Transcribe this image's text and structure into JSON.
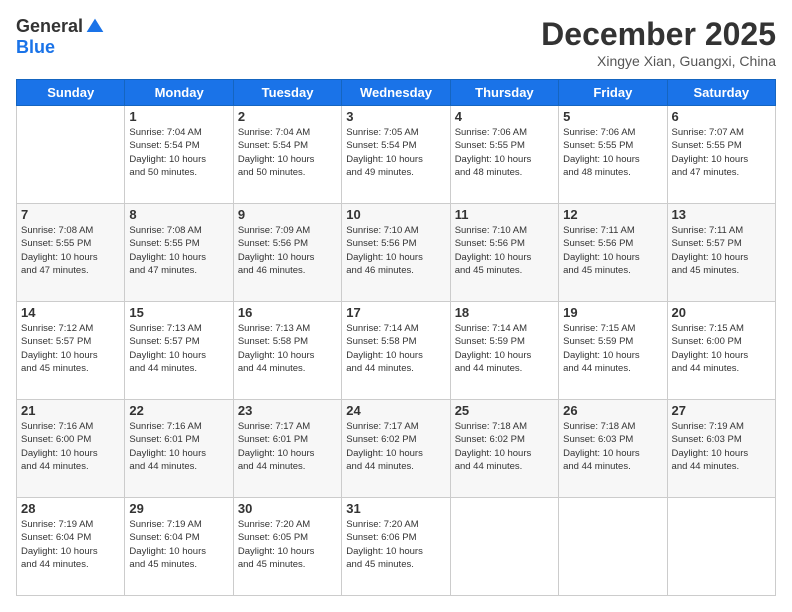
{
  "logo": {
    "general": "General",
    "blue": "Blue"
  },
  "header": {
    "month": "December 2025",
    "location": "Xingye Xian, Guangxi, China"
  },
  "weekdays": [
    "Sunday",
    "Monday",
    "Tuesday",
    "Wednesday",
    "Thursday",
    "Friday",
    "Saturday"
  ],
  "weeks": [
    [
      {
        "day": "",
        "info": ""
      },
      {
        "day": "1",
        "info": "Sunrise: 7:04 AM\nSunset: 5:54 PM\nDaylight: 10 hours\nand 50 minutes."
      },
      {
        "day": "2",
        "info": "Sunrise: 7:04 AM\nSunset: 5:54 PM\nDaylight: 10 hours\nand 50 minutes."
      },
      {
        "day": "3",
        "info": "Sunrise: 7:05 AM\nSunset: 5:54 PM\nDaylight: 10 hours\nand 49 minutes."
      },
      {
        "day": "4",
        "info": "Sunrise: 7:06 AM\nSunset: 5:55 PM\nDaylight: 10 hours\nand 48 minutes."
      },
      {
        "day": "5",
        "info": "Sunrise: 7:06 AM\nSunset: 5:55 PM\nDaylight: 10 hours\nand 48 minutes."
      },
      {
        "day": "6",
        "info": "Sunrise: 7:07 AM\nSunset: 5:55 PM\nDaylight: 10 hours\nand 47 minutes."
      }
    ],
    [
      {
        "day": "7",
        "info": "Sunrise: 7:08 AM\nSunset: 5:55 PM\nDaylight: 10 hours\nand 47 minutes."
      },
      {
        "day": "8",
        "info": "Sunrise: 7:08 AM\nSunset: 5:55 PM\nDaylight: 10 hours\nand 47 minutes."
      },
      {
        "day": "9",
        "info": "Sunrise: 7:09 AM\nSunset: 5:56 PM\nDaylight: 10 hours\nand 46 minutes."
      },
      {
        "day": "10",
        "info": "Sunrise: 7:10 AM\nSunset: 5:56 PM\nDaylight: 10 hours\nand 46 minutes."
      },
      {
        "day": "11",
        "info": "Sunrise: 7:10 AM\nSunset: 5:56 PM\nDaylight: 10 hours\nand 45 minutes."
      },
      {
        "day": "12",
        "info": "Sunrise: 7:11 AM\nSunset: 5:56 PM\nDaylight: 10 hours\nand 45 minutes."
      },
      {
        "day": "13",
        "info": "Sunrise: 7:11 AM\nSunset: 5:57 PM\nDaylight: 10 hours\nand 45 minutes."
      }
    ],
    [
      {
        "day": "14",
        "info": "Sunrise: 7:12 AM\nSunset: 5:57 PM\nDaylight: 10 hours\nand 45 minutes."
      },
      {
        "day": "15",
        "info": "Sunrise: 7:13 AM\nSunset: 5:57 PM\nDaylight: 10 hours\nand 44 minutes."
      },
      {
        "day": "16",
        "info": "Sunrise: 7:13 AM\nSunset: 5:58 PM\nDaylight: 10 hours\nand 44 minutes."
      },
      {
        "day": "17",
        "info": "Sunrise: 7:14 AM\nSunset: 5:58 PM\nDaylight: 10 hours\nand 44 minutes."
      },
      {
        "day": "18",
        "info": "Sunrise: 7:14 AM\nSunset: 5:59 PM\nDaylight: 10 hours\nand 44 minutes."
      },
      {
        "day": "19",
        "info": "Sunrise: 7:15 AM\nSunset: 5:59 PM\nDaylight: 10 hours\nand 44 minutes."
      },
      {
        "day": "20",
        "info": "Sunrise: 7:15 AM\nSunset: 6:00 PM\nDaylight: 10 hours\nand 44 minutes."
      }
    ],
    [
      {
        "day": "21",
        "info": "Sunrise: 7:16 AM\nSunset: 6:00 PM\nDaylight: 10 hours\nand 44 minutes."
      },
      {
        "day": "22",
        "info": "Sunrise: 7:16 AM\nSunset: 6:01 PM\nDaylight: 10 hours\nand 44 minutes."
      },
      {
        "day": "23",
        "info": "Sunrise: 7:17 AM\nSunset: 6:01 PM\nDaylight: 10 hours\nand 44 minutes."
      },
      {
        "day": "24",
        "info": "Sunrise: 7:17 AM\nSunset: 6:02 PM\nDaylight: 10 hours\nand 44 minutes."
      },
      {
        "day": "25",
        "info": "Sunrise: 7:18 AM\nSunset: 6:02 PM\nDaylight: 10 hours\nand 44 minutes."
      },
      {
        "day": "26",
        "info": "Sunrise: 7:18 AM\nSunset: 6:03 PM\nDaylight: 10 hours\nand 44 minutes."
      },
      {
        "day": "27",
        "info": "Sunrise: 7:19 AM\nSunset: 6:03 PM\nDaylight: 10 hours\nand 44 minutes."
      }
    ],
    [
      {
        "day": "28",
        "info": "Sunrise: 7:19 AM\nSunset: 6:04 PM\nDaylight: 10 hours\nand 44 minutes."
      },
      {
        "day": "29",
        "info": "Sunrise: 7:19 AM\nSunset: 6:04 PM\nDaylight: 10 hours\nand 45 minutes."
      },
      {
        "day": "30",
        "info": "Sunrise: 7:20 AM\nSunset: 6:05 PM\nDaylight: 10 hours\nand 45 minutes."
      },
      {
        "day": "31",
        "info": "Sunrise: 7:20 AM\nSunset: 6:06 PM\nDaylight: 10 hours\nand 45 minutes."
      },
      {
        "day": "",
        "info": ""
      },
      {
        "day": "",
        "info": ""
      },
      {
        "day": "",
        "info": ""
      }
    ]
  ]
}
